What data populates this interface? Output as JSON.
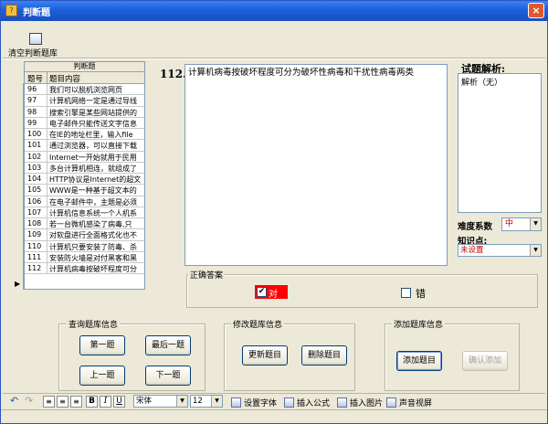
{
  "window": {
    "title": "判断题",
    "close_label": "×",
    "app_icon": "quiz-icon"
  },
  "toolbar": {
    "clear_label": "清空判断题库",
    "clear_icon": "clear-library-icon"
  },
  "grid": {
    "caption": "判断题",
    "headers": [
      "题号",
      "题目内容"
    ],
    "rows": [
      {
        "id": "96",
        "text": "我们可以脱机浏览网页"
      },
      {
        "id": "97",
        "text": "计算机网络一定是通过导线"
      },
      {
        "id": "98",
        "text": "搜索引擎是某些网站提供的"
      },
      {
        "id": "99",
        "text": "电子邮件只能传送文字信息"
      },
      {
        "id": "100",
        "text": "在IE的地址栏里，输入file"
      },
      {
        "id": "101",
        "text": "通过浏览器，可以直接下载"
      },
      {
        "id": "102",
        "text": "Internet一开始就用于民用"
      },
      {
        "id": "103",
        "text": "多台计算机相连，就组成了"
      },
      {
        "id": "104",
        "text": "HTTP协议是Internet的超文"
      },
      {
        "id": "105",
        "text": "WWW是一种基于超文本的"
      },
      {
        "id": "106",
        "text": "在电子邮件中，主题是必须"
      },
      {
        "id": "107",
        "text": "计算机信息系统一个人机系"
      },
      {
        "id": "108",
        "text": "若一台微机感染了病毒,只"
      },
      {
        "id": "109",
        "text": "对软盘进行全面格式化也不"
      },
      {
        "id": "110",
        "text": "计算机只要安装了防毒、杀"
      },
      {
        "id": "111",
        "text": "安装防火墙是对付黑客和黑"
      },
      {
        "id": "112",
        "text": "计算机病毒按破坏程度可分"
      }
    ],
    "current_marker": "▶"
  },
  "question": {
    "number": "112.",
    "text": "计算机病毒按破坏程度可分为破坏性病毒和干扰性病毒两类"
  },
  "analysis": {
    "title": "试题解析:",
    "text": "解析（无）"
  },
  "difficulty": {
    "label": "难度系数",
    "value": "中"
  },
  "knowledge": {
    "label": "知识点:",
    "value": "未设置"
  },
  "answer": {
    "legend": "正确答案",
    "true_label": "对",
    "false_label": "错",
    "true_checked": true,
    "false_checked": false,
    "highlight_color": "#ff0000"
  },
  "query_group": {
    "legend": "查询题库信息",
    "first": "第一题",
    "last": "最后一题",
    "prev": "上一题",
    "next": "下一题"
  },
  "edit_group": {
    "legend": "修改题库信息",
    "update": "更新题目",
    "delete": "删除题目"
  },
  "add_group": {
    "legend": "添加题库信息",
    "add": "添加题目",
    "confirm": "确认添加"
  },
  "editor_bar": {
    "undo_icon": "undo-icon",
    "redo_icon": "redo-icon",
    "align_left_icon": "align-left-icon",
    "align_center_icon": "align-center-icon",
    "align_right_icon": "align-right-icon",
    "bold": "B",
    "italic": "I",
    "underline": "U",
    "font": "宋体",
    "size": "12",
    "set_font": "设置字体",
    "insert_formula": "插入公式",
    "insert_image": "插入图片",
    "sound_video": "声音视屏"
  }
}
